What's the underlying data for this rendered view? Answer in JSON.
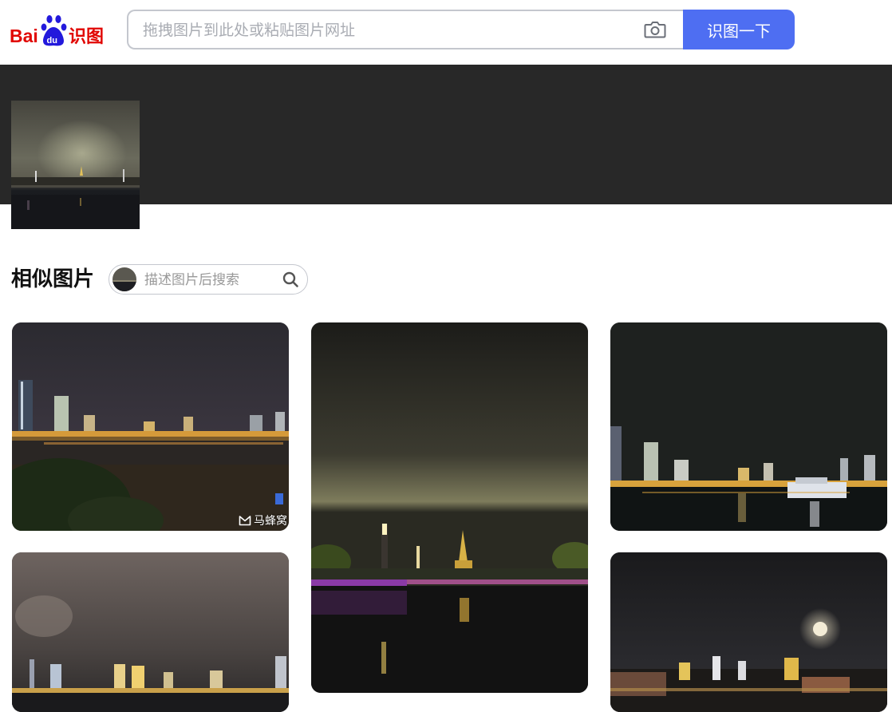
{
  "header": {
    "logo_text": "Bai du 识图",
    "search_placeholder": "拖拽图片到此处或粘贴图片网址",
    "search_button_label": "识图一下"
  },
  "similar": {
    "title": "相似图片",
    "describe_placeholder": "描述图片后搜索",
    "results": [
      {
        "kind": "city-skyline-night",
        "source": "马蜂窝"
      },
      {
        "kind": "pagoda-waterfront-night"
      },
      {
        "kind": "city-skyline-river-boat"
      },
      {
        "kind": "foggy-skyline-night"
      },
      {
        "kind": "moon-over-city-night"
      }
    ]
  },
  "colors": {
    "brand_blue": "#4e6ef2",
    "logo_red": "#e10602",
    "logo_blue": "#2319dc",
    "hero_bg": "#282828"
  },
  "icons": [
    "baidu-paw-icon",
    "camera-icon",
    "search-icon",
    "mafengwo-logo-icon"
  ]
}
